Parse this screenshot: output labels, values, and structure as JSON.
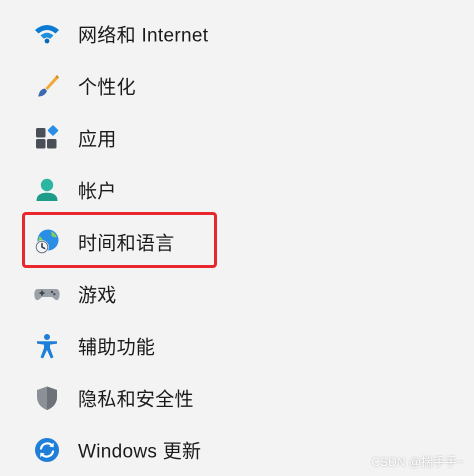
{
  "nav": {
    "items": [
      {
        "label": "网络和 Internet",
        "icon": "wifi-icon"
      },
      {
        "label": "个性化",
        "icon": "paintbrush-icon"
      },
      {
        "label": "应用",
        "icon": "apps-icon"
      },
      {
        "label": "帐户",
        "icon": "person-icon"
      },
      {
        "label": "时间和语言",
        "icon": "globe-clock-icon",
        "highlighted": true
      },
      {
        "label": "游戏",
        "icon": "gamepad-icon"
      },
      {
        "label": "辅助功能",
        "icon": "accessibility-icon"
      },
      {
        "label": "隐私和安全性",
        "icon": "shield-icon"
      },
      {
        "label": "Windows 更新",
        "icon": "sync-icon"
      }
    ]
  },
  "highlight_color": "#e8262b",
  "watermark": "CSDN @揣手手~"
}
